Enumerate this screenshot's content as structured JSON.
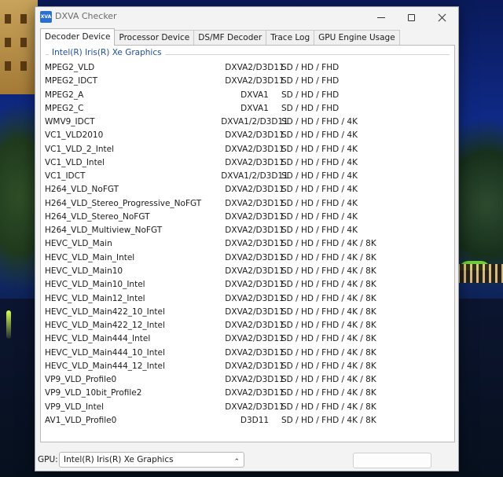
{
  "window": {
    "icon_text": "XVA",
    "title": "DXVA Checker"
  },
  "tabs": [
    {
      "label": "Decoder Device"
    },
    {
      "label": "Processor Device"
    },
    {
      "label": "DS/MF Decoder"
    },
    {
      "label": "Trace Log"
    },
    {
      "label": "GPU Engine Usage"
    }
  ],
  "group": {
    "title": "Intel(R) Iris(R) Xe Graphics"
  },
  "decoders": [
    {
      "name": "MPEG2_VLD",
      "api": "DXVA2/D3D11",
      "res": "SD / HD / FHD"
    },
    {
      "name": "MPEG2_IDCT",
      "api": "DXVA2/D3D11",
      "res": "SD / HD / FHD"
    },
    {
      "name": "MPEG2_A",
      "api": "DXVA1",
      "res": "SD / HD / FHD"
    },
    {
      "name": "MPEG2_C",
      "api": "DXVA1",
      "res": "SD / HD / FHD"
    },
    {
      "name": "WMV9_IDCT",
      "api": "DXVA1/2/D3D11",
      "res": "SD / HD / FHD / 4K"
    },
    {
      "name": "VC1_VLD2010",
      "api": "DXVA2/D3D11",
      "res": "SD / HD / FHD / 4K"
    },
    {
      "name": "VC1_VLD_2_Intel",
      "api": "DXVA2/D3D11",
      "res": "SD / HD / FHD / 4K"
    },
    {
      "name": "VC1_VLD_Intel",
      "api": "DXVA2/D3D11",
      "res": "SD / HD / FHD / 4K"
    },
    {
      "name": "VC1_IDCT",
      "api": "DXVA1/2/D3D11",
      "res": "SD / HD / FHD / 4K"
    },
    {
      "name": "H264_VLD_NoFGT",
      "api": "DXVA2/D3D11",
      "res": "SD / HD / FHD / 4K"
    },
    {
      "name": "H264_VLD_Stereo_Progressive_NoFGT",
      "api": "DXVA2/D3D11",
      "res": "SD / HD / FHD / 4K"
    },
    {
      "name": "H264_VLD_Stereo_NoFGT",
      "api": "DXVA2/D3D11",
      "res": "SD / HD / FHD / 4K"
    },
    {
      "name": "H264_VLD_Multiview_NoFGT",
      "api": "DXVA2/D3D11",
      "res": "SD / HD / FHD / 4K"
    },
    {
      "name": "HEVC_VLD_Main",
      "api": "DXVA2/D3D11",
      "res": "SD / HD / FHD / 4K / 8K"
    },
    {
      "name": "HEVC_VLD_Main_Intel",
      "api": "DXVA2/D3D11",
      "res": "SD / HD / FHD / 4K / 8K"
    },
    {
      "name": "HEVC_VLD_Main10",
      "api": "DXVA2/D3D11",
      "res": "SD / HD / FHD / 4K / 8K"
    },
    {
      "name": "HEVC_VLD_Main10_Intel",
      "api": "DXVA2/D3D11",
      "res": "SD / HD / FHD / 4K / 8K"
    },
    {
      "name": "HEVC_VLD_Main12_Intel",
      "api": "DXVA2/D3D11",
      "res": "SD / HD / FHD / 4K / 8K"
    },
    {
      "name": "HEVC_VLD_Main422_10_Intel",
      "api": "DXVA2/D3D11",
      "res": "SD / HD / FHD / 4K / 8K"
    },
    {
      "name": "HEVC_VLD_Main422_12_Intel",
      "api": "DXVA2/D3D11",
      "res": "SD / HD / FHD / 4K / 8K"
    },
    {
      "name": "HEVC_VLD_Main444_Intel",
      "api": "DXVA2/D3D11",
      "res": "SD / HD / FHD / 4K / 8K"
    },
    {
      "name": "HEVC_VLD_Main444_10_Intel",
      "api": "DXVA2/D3D11",
      "res": "SD / HD / FHD / 4K / 8K"
    },
    {
      "name": "HEVC_VLD_Main444_12_Intel",
      "api": "DXVA2/D3D11",
      "res": "SD / HD / FHD / 4K / 8K"
    },
    {
      "name": "VP9_VLD_Profile0",
      "api": "DXVA2/D3D11",
      "res": "SD / HD / FHD / 4K / 8K"
    },
    {
      "name": "VP9_VLD_10bit_Profile2",
      "api": "DXVA2/D3D11",
      "res": "SD / HD / FHD / 4K / 8K"
    },
    {
      "name": "VP9_VLD_Intel",
      "api": "DXVA2/D3D11",
      "res": "SD / HD / FHD / 4K / 8K"
    },
    {
      "name": "AV1_VLD_Profile0",
      "api": "D3D11",
      "res": "SD / HD / FHD / 4K / 8K"
    }
  ],
  "footer": {
    "gpu_label": "GPU:",
    "gpu_selected": "Intel(R) Iris(R) Xe Graphics"
  },
  "icons": {
    "app": "dxva-app-icon",
    "dropdown": "chevron-up-icon"
  },
  "colors": {
    "group_title": "#1f4e9c",
    "app_icon": "#2a6fd1"
  }
}
